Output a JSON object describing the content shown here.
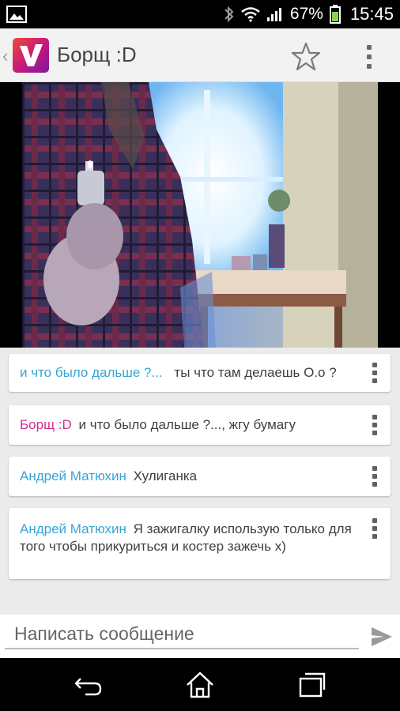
{
  "status_bar": {
    "battery_percent": "67%",
    "time": "15:45",
    "icons": [
      "gallery-icon",
      "bluetooth-icon",
      "wifi-icon",
      "signal-icon",
      "battery-icon"
    ]
  },
  "action_bar": {
    "title": "Борщ :D",
    "logo_icon": "app-logo-v",
    "icons": [
      "star-icon",
      "overflow-menu-icon"
    ]
  },
  "messages": [
    {
      "author": "и что было дальше ?...",
      "text": "ты что там делаешь О.о ?",
      "author_color": "#36a5d4"
    },
    {
      "author": "Борщ :D",
      "text": "и что было дальше ?..., жгу бумагу",
      "author_color": "#d42e8f"
    },
    {
      "author": "Андрей Матюхин",
      "text": "Хулиганка",
      "author_color": "#36a5d4"
    },
    {
      "author": "Андрей Матюхин",
      "text": "Я зажигалку использую только для того чтобы прикуриться и костер зажечь х)",
      "author_color": "#36a5d4"
    }
  ],
  "composer": {
    "placeholder": "Написать сообщение",
    "value": "",
    "send_icon": "send-icon"
  },
  "nav_bar": {
    "icons": [
      "back-icon",
      "home-icon",
      "recent-apps-icon"
    ]
  },
  "colors": {
    "accent_blue": "#36a5d4",
    "accent_pink": "#d42e8f"
  }
}
